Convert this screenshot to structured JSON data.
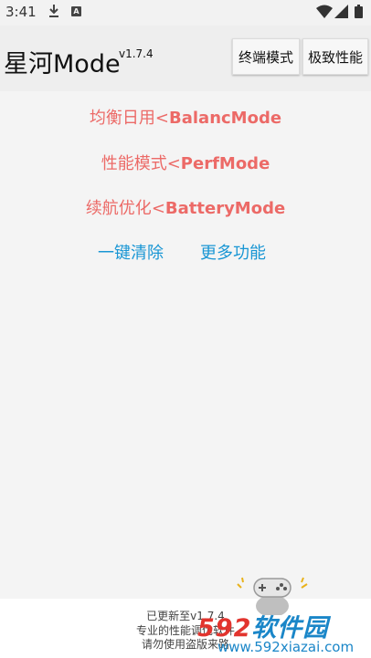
{
  "status_bar": {
    "time": "3:41",
    "icons": [
      "download-icon",
      "a-badge-icon",
      "wifi-icon",
      "signal-icon",
      "battery-icon"
    ],
    "a_badge": "A"
  },
  "app_bar": {
    "title": "星河Mode",
    "version": "v1.7.4",
    "buttons": [
      "终端模式",
      "极致性能"
    ]
  },
  "modes": [
    {
      "label": "均衡日用",
      "arrow": "<",
      "code": "BalancMode"
    },
    {
      "label": "性能模式",
      "arrow": "<",
      "code": "PerfMode"
    },
    {
      "label": "续航优化",
      "arrow": "<",
      "code": "BatteryMode"
    }
  ],
  "actions": [
    "一键清除",
    "更多功能"
  ],
  "footer": {
    "line1": "已更新至v1.7.4",
    "line2": "专业的性能调优软件",
    "line3": "请勿使用盗版来路"
  },
  "watermark": {
    "number": "592",
    "text": "软件园",
    "url": "www.592xiazai.com"
  },
  "colors": {
    "mode_text": "#ec6a67",
    "action_text": "#1996d4",
    "watermark_red": "#e2342e",
    "watermark_blue": "#1a86c8"
  }
}
